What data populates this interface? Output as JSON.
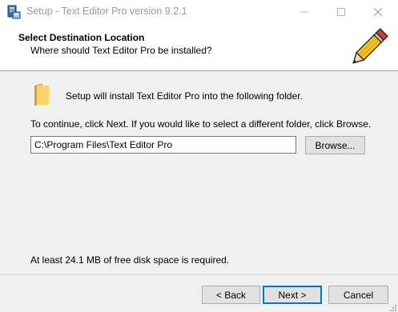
{
  "window": {
    "title": "Setup - Text Editor Pro version 9.2.1"
  },
  "header": {
    "title": "Select Destination Location",
    "subtitle": "Where should Text Editor Pro be installed?"
  },
  "main": {
    "install_text": "Setup will install Text Editor Pro into the following folder.",
    "continue_text": "To continue, click Next. If you would like to select a different folder, click Browse.",
    "path_value": "C:\\Program Files\\Text Editor Pro",
    "browse_label": "Browse...",
    "disk_space_text": "At least 24.1 MB of free disk space is required."
  },
  "footer": {
    "back_label": "< Back",
    "next_label": "Next >",
    "cancel_label": "Cancel"
  },
  "icons": {
    "app": "setup-app-icon",
    "header": "pencil-icon",
    "folder": "folder-icon"
  },
  "colors": {
    "focus_border": "#0078d7",
    "title_text": "#9a9a9a",
    "folder": "#f0c34a"
  }
}
